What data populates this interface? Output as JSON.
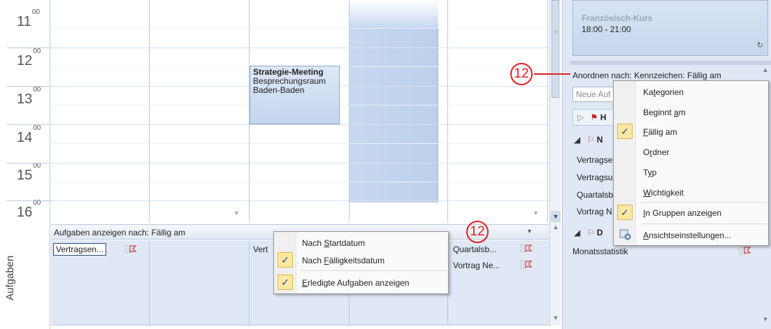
{
  "calendar": {
    "hours": [
      {
        "h": "11",
        "m": "00"
      },
      {
        "h": "12",
        "m": "00"
      },
      {
        "h": "13",
        "m": "00"
      },
      {
        "h": "14",
        "m": "00"
      },
      {
        "h": "15",
        "m": "00"
      },
      {
        "h": "16",
        "m": "00"
      }
    ],
    "appointment": {
      "title": "Strategie-Meeting",
      "room": "Besprechungsraum",
      "place": "Baden-Baden"
    }
  },
  "tasks_band": {
    "side_label": "Aufgaben",
    "header": "Aufgaben anzeigen nach: Fällig am",
    "items": {
      "col1": "Vertragsen...",
      "col3": "Vert",
      "col6a": "Quartalsb...",
      "col6b": "Vortrag Ne..."
    }
  },
  "tasks_menu": {
    "items": [
      {
        "label_pre": "Nach ",
        "label_u": "S",
        "label_post": "tartdatum",
        "checked": false
      },
      {
        "label_pre": "Nach ",
        "label_u": "F",
        "label_post": "älligkeitsdatum",
        "checked": true
      },
      {
        "label_pre": "",
        "label_u": "E",
        "label_post": "rledigte Aufgaben anzeigen",
        "checked": true
      }
    ]
  },
  "right_pane": {
    "card_title": "Französisch-Kurs",
    "card_time": "18:00 - 21:00",
    "arrange_label": "Anordnen nach: Kennzeichen: Fällig am",
    "new_task_placeholder": "Neue Auf",
    "group_rows": [
      {
        "prefix": "H"
      },
      {
        "prefix": "N"
      }
    ],
    "task_list": [
      "Vertragse",
      "Vertragsu",
      "Quartalsb",
      "Vortrag N"
    ],
    "group_d": "D",
    "last_item": "Monatsstatistik"
  },
  "arrange_menu": {
    "items": [
      {
        "pre": "Ka",
        "u": "t",
        "post": "egorien",
        "checked": false
      },
      {
        "pre": "Beginnt ",
        "u": "a",
        "post": "m",
        "checked": false
      },
      {
        "pre": "",
        "u": "F",
        "post": "ällig am",
        "checked": true
      },
      {
        "pre": "O",
        "u": "r",
        "post": "dner",
        "checked": false
      },
      {
        "pre": "T",
        "u": "y",
        "post": "p",
        "checked": false
      },
      {
        "pre": "",
        "u": "W",
        "post": "ichtigkeit",
        "checked": false
      },
      {
        "pre": "",
        "u": "I",
        "post": "n Gruppen anzeigen",
        "checked": true
      },
      {
        "pre": "",
        "u": "A",
        "post": "nsichtseinstellungen...",
        "checked": false
      }
    ]
  },
  "callouts": [
    "12",
    "12"
  ],
  "colors": {
    "accent": "#e02020",
    "check_bg": "#fde8a3",
    "pane_bg": "#dfe8f4"
  }
}
